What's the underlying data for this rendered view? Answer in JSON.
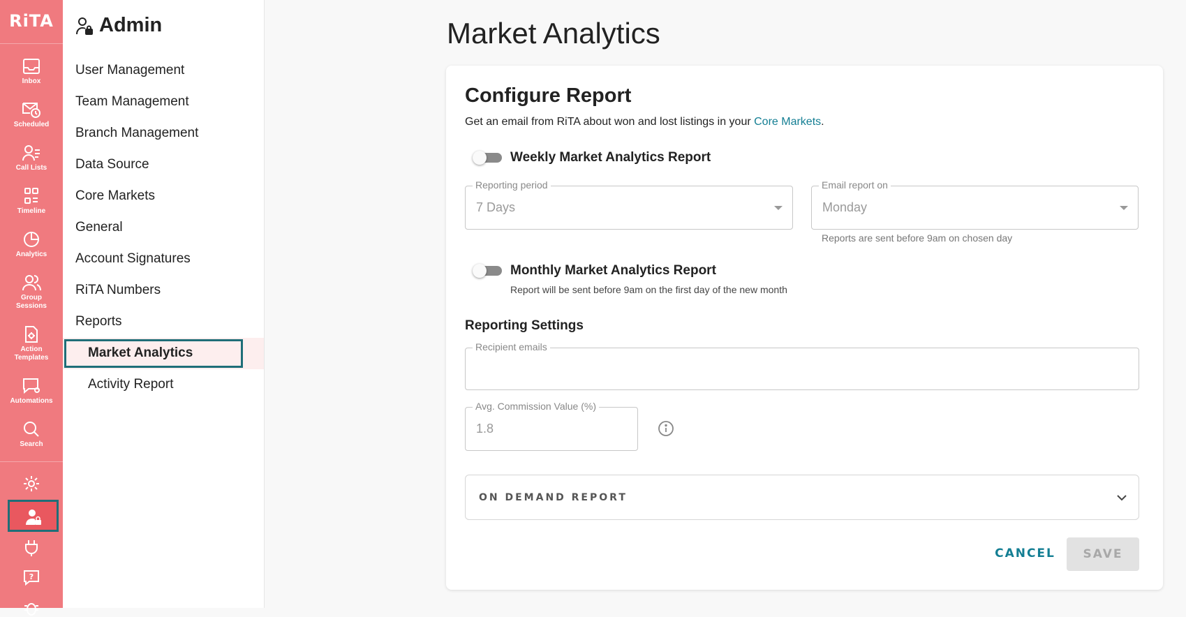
{
  "rail": {
    "logo": "RiTA",
    "items": [
      {
        "label": "Inbox",
        "icon": "inbox-icon"
      },
      {
        "label": "Scheduled",
        "icon": "scheduled-icon"
      },
      {
        "label": "Call Lists",
        "icon": "call-lists-icon"
      },
      {
        "label": "Timeline",
        "icon": "timeline-icon"
      },
      {
        "label": "Analytics",
        "icon": "analytics-icon"
      },
      {
        "label": "Group Sessions",
        "icon": "group-sessions-icon"
      },
      {
        "label": "Action Templates",
        "icon": "action-templates-icon"
      },
      {
        "label": "Automations",
        "icon": "automations-icon"
      },
      {
        "label": "Search",
        "icon": "search-icon"
      }
    ],
    "bottom_icons": [
      "gear-icon",
      "admin-icon",
      "plug-icon",
      "help-icon",
      "bug-icon"
    ]
  },
  "sidebar": {
    "title": "Admin",
    "items": [
      "User Management",
      "Team Management",
      "Branch Management",
      "Data Source",
      "Core Markets",
      "General",
      "Account Signatures",
      "RiTA Numbers",
      "Reports"
    ],
    "sub_items": [
      "Market Analytics",
      "Activity Report"
    ],
    "active": "Market Analytics"
  },
  "main": {
    "title": "Market Analytics",
    "card": {
      "title": "Configure Report",
      "description_prefix": "Get an email from RiTA about won and lost listings in your ",
      "description_link": "Core Markets",
      "description_suffix": ".",
      "weekly": {
        "label": "Weekly Market Analytics Report",
        "enabled": false,
        "period_label": "Reporting period",
        "period_value": "7 Days",
        "email_on_label": "Email report on",
        "email_on_value": "Monday",
        "email_on_helper": "Reports are sent before 9am on chosen day"
      },
      "monthly": {
        "label": "Monthly Market Analytics Report",
        "enabled": false,
        "helper": "Report will be sent before 9am on the first day of the new month"
      },
      "settings": {
        "title": "Reporting Settings",
        "recipient_label": "Recipient emails",
        "recipient_value": "",
        "commission_label": "Avg. Commission Value (%)",
        "commission_value": "1.8"
      },
      "on_demand_label": "ON DEMAND REPORT",
      "cancel_label": "CANCEL",
      "save_label": "SAVE"
    }
  },
  "colors": {
    "rail": "#f07a7f",
    "active_outline": "#1f6e78",
    "link": "#137e93"
  }
}
